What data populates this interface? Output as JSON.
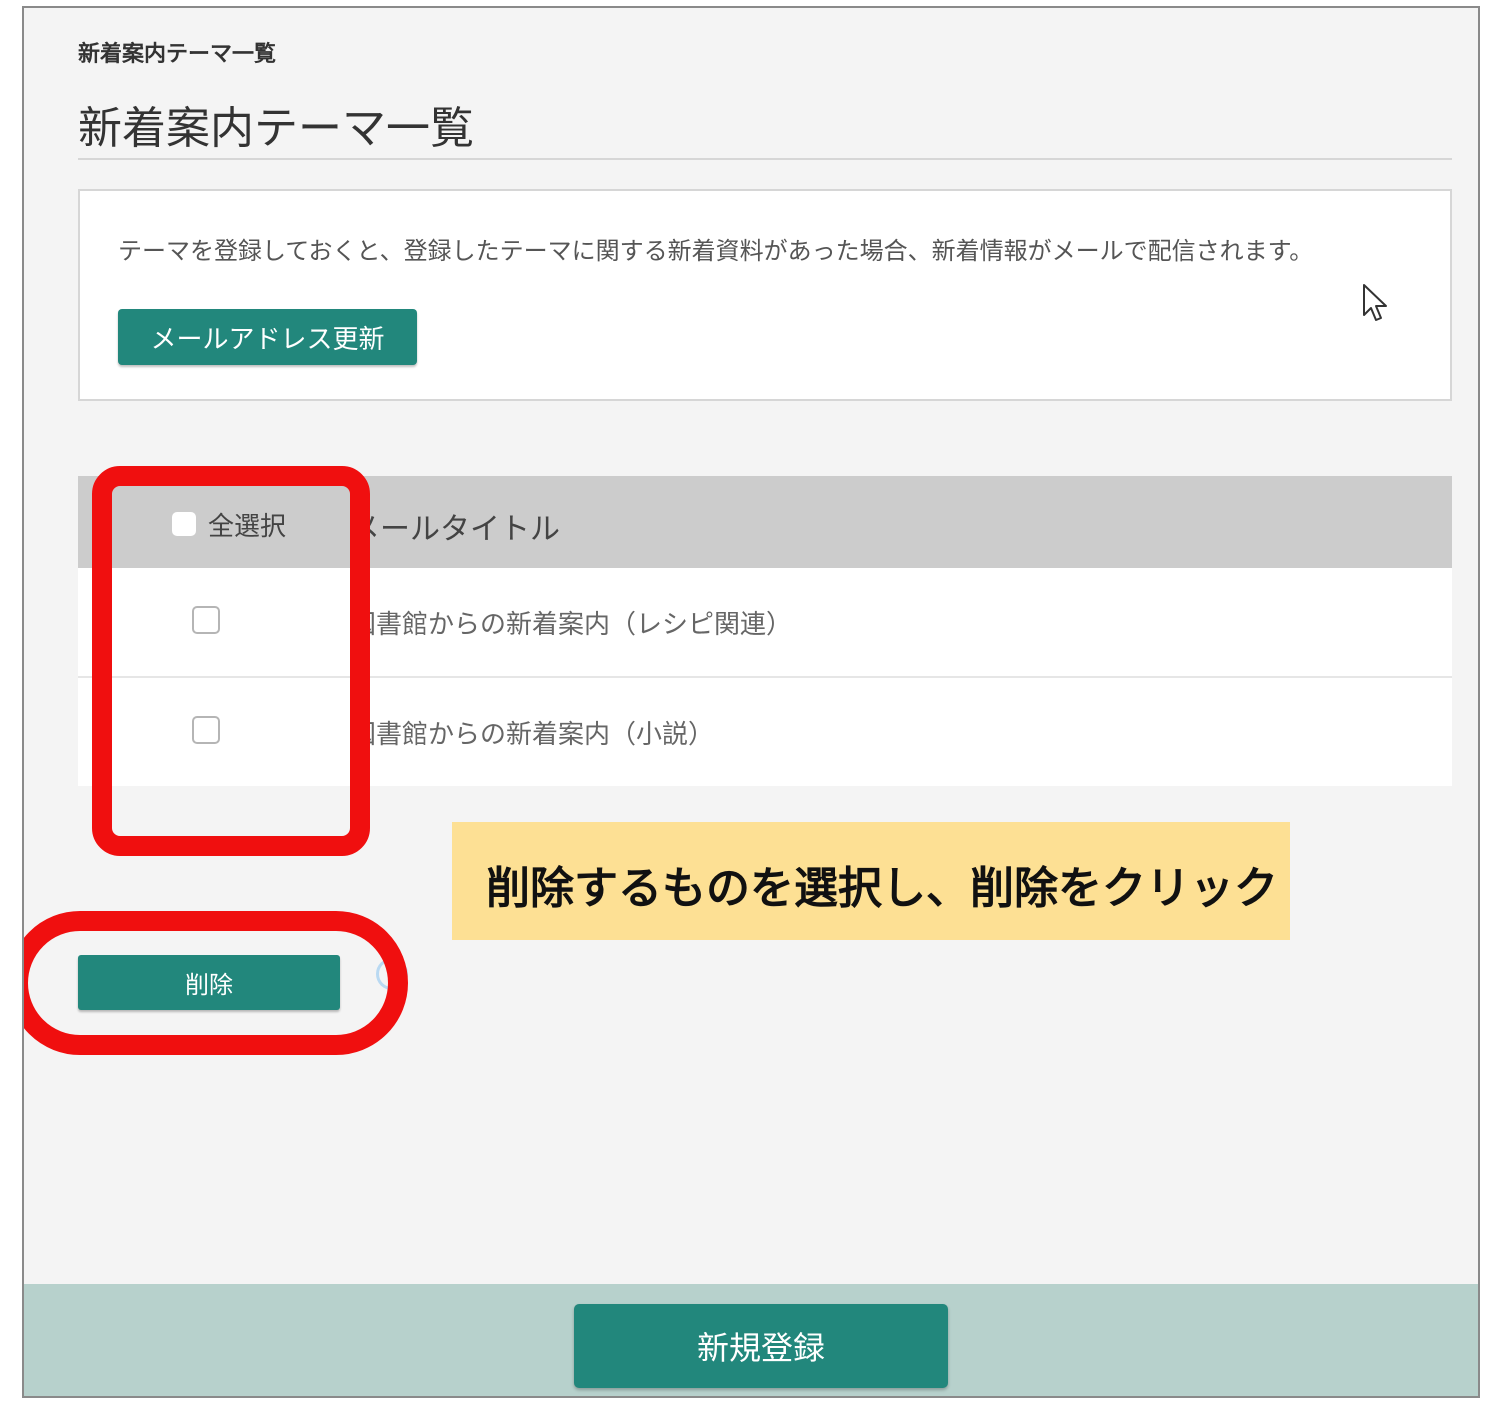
{
  "breadcrumb": "新着案内テーマ一覧",
  "page_title": "新着案内テーマ一覧",
  "info": {
    "text": "テーマを登録しておくと、登録したテーマに関する新着資料があった場合、新着情報がメールで配信されます。",
    "mail_button_label": "メールアドレス更新"
  },
  "table": {
    "select_all_label": "全選択",
    "title_header": "メールタイトル",
    "rows": [
      {
        "title": "図書館からの新着案内（レシピ関連）",
        "checked": false
      },
      {
        "title": "図書館からの新着案内（小説）",
        "checked": false
      }
    ]
  },
  "callout_text": "削除するものを選択し、削除をクリック",
  "delete_button_label": "削除",
  "new_button_label": "新規登録",
  "colors": {
    "button": "#22877c",
    "footer": "#b7d1cc",
    "highlight": "#f00f0f",
    "callout": "#fde094"
  },
  "icons": [
    "cursor-icon",
    "loading-icon"
  ]
}
